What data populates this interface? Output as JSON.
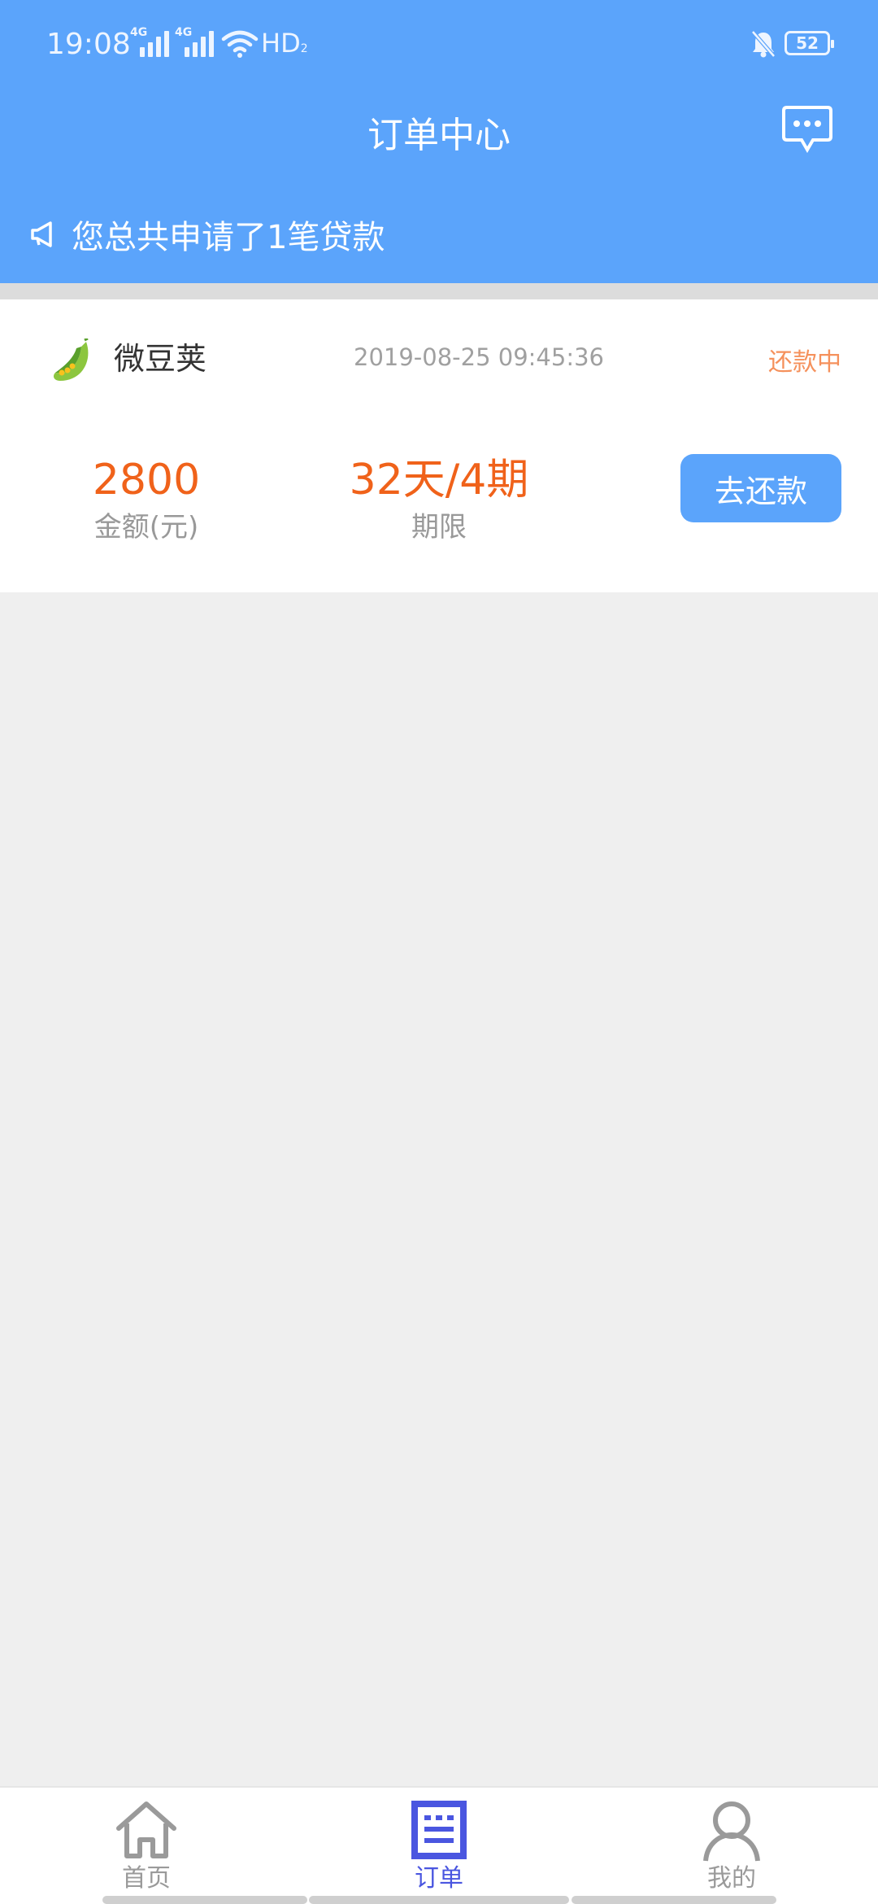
{
  "status_bar": {
    "time": "19:08",
    "signal_1_label": "4G",
    "signal_2_label": "4G",
    "hd_label": "HD",
    "hd_sub": "2",
    "battery": "52"
  },
  "header": {
    "title": "订单中心",
    "message_icon": "chat-bubble-icon"
  },
  "notice": {
    "icon": "megaphone-icon",
    "text": "您总共申请了1笔贷款"
  },
  "order": {
    "product_name": "微豆荚",
    "product_icon": "pea-pod-logo",
    "time": "2019-08-25 09:45:36",
    "status": "还款中",
    "amount_value": "2800",
    "amount_label": "金额(元)",
    "term_value": "32天/4期",
    "term_label": "期限",
    "action_label": "去还款"
  },
  "tabs": [
    {
      "label": "首页",
      "icon": "home-icon",
      "active": false
    },
    {
      "label": "订单",
      "icon": "order-list-icon",
      "active": true
    },
    {
      "label": "我的",
      "icon": "user-icon",
      "active": false
    }
  ],
  "colors": {
    "primary": "#5ba4fb",
    "accent_orange": "#f0621a",
    "status_orange": "#f5915c",
    "tab_active": "#4a56e0"
  }
}
